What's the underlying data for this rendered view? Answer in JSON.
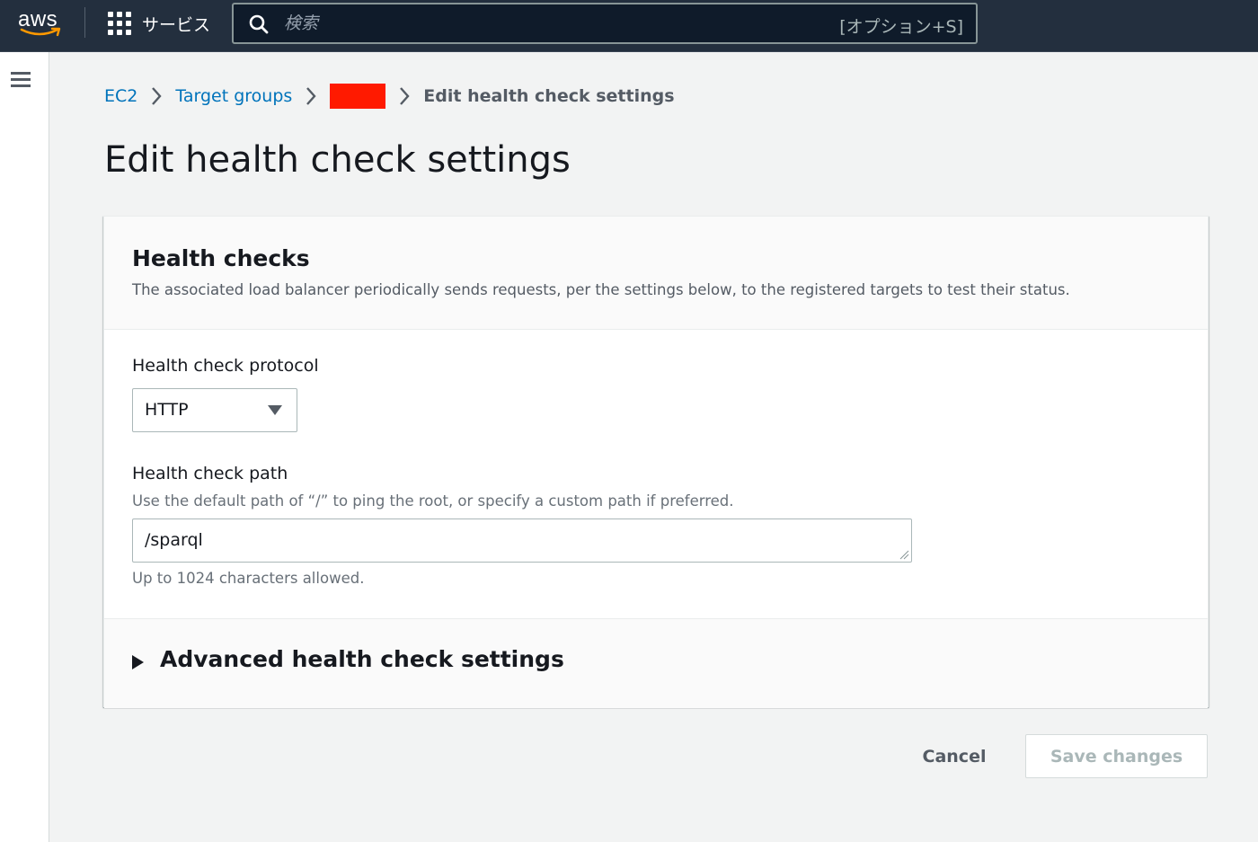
{
  "topbar": {
    "logo_text": "aws",
    "services_label": "サービス",
    "search": {
      "placeholder": "検索",
      "shortcut": "[オプション+S]"
    }
  },
  "breadcrumb": {
    "items": [
      {
        "label": "EC2"
      },
      {
        "label": "Target groups"
      },
      {
        "label": ""
      },
      {
        "label": "Edit health check settings"
      }
    ]
  },
  "page": {
    "title": "Edit health check settings"
  },
  "panel": {
    "title": "Health checks",
    "description": "The associated load balancer periodically sends requests, per the settings below, to the registered targets to test their status.",
    "protocol": {
      "label": "Health check protocol",
      "value": "HTTP"
    },
    "path": {
      "label": "Health check path",
      "description": "Use the default path of “/” to ping the root, or specify a custom path if preferred.",
      "value": "/sparql",
      "constraint": "Up to 1024 characters allowed."
    },
    "advanced": {
      "label": "Advanced health check settings",
      "expanded": false
    }
  },
  "actions": {
    "cancel_label": "Cancel",
    "save_label": "Save changes"
  },
  "colors": {
    "topbar": "#232f3e",
    "link": "#0073bb",
    "redaction": "#ff1a00",
    "disabled_text": "#aab7b8"
  }
}
